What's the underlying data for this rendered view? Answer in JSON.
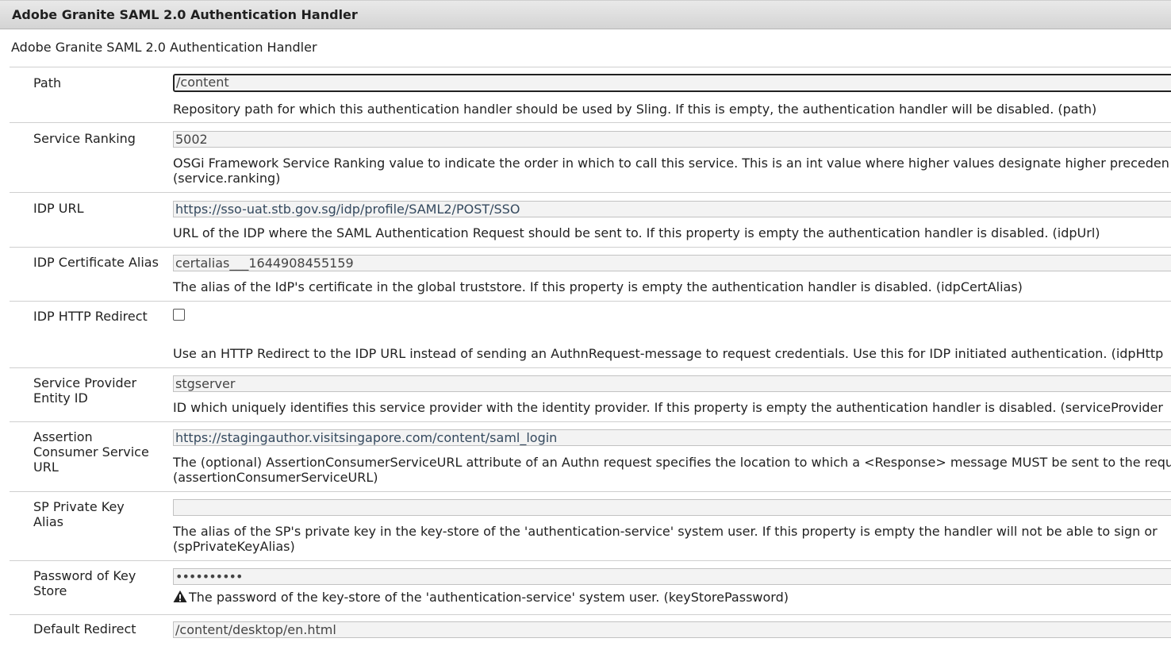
{
  "window": {
    "title": "Adobe Granite SAML 2.0 Authentication Handler"
  },
  "subtitle": "Adobe Granite SAML 2.0 Authentication Handler",
  "fields": [
    {
      "label": "Path",
      "value": "/content",
      "description": "Repository path for which this authentication handler should be used by Sling. If this is empty, the authentication handler will be disabled. (path)"
    },
    {
      "label": "Service Ranking",
      "value": "5002",
      "description_line1": "OSGi Framework Service Ranking value to indicate the order in which to call this service. This is an int value where higher values designate higher preceden",
      "description_line2": "(service.ranking)"
    },
    {
      "label": "IDP URL",
      "value": "https://sso-uat.stb.gov.sg/idp/profile/SAML2/POST/SSO",
      "description": "URL of the IDP where the SAML Authentication Request should be sent to. If this property is empty the authentication handler is disabled. (idpUrl)"
    },
    {
      "label": "IDP Certificate Alias",
      "value": "certalias___1644908455159",
      "description": "The alias of the IdP's certificate in the global truststore. If this property is empty the authentication handler is disabled. (idpCertAlias)"
    },
    {
      "label": "IDP HTTP Redirect",
      "checked": false,
      "description": "Use an HTTP Redirect to the IDP URL instead of sending an AuthnRequest-message to request credentials. Use this for IDP initiated authentication. (idpHttp"
    },
    {
      "label_line1": "Service Provider",
      "label_line2": "Entity ID",
      "value": "stgserver",
      "description": "ID which uniquely identifies this service provider with the identity provider. If this property is empty the authentication handler is disabled. (serviceProvider"
    },
    {
      "label_line1": "Assertion",
      "label_line2": "Consumer Service",
      "label_line3": "URL",
      "value": "https://stagingauthor.visitsingapore.com/content/saml_login",
      "description_line1": "The (optional) AssertionConsumerServiceURL attribute of an Authn request specifies the location to which a <Response> message MUST be sent to the requ",
      "description_line2": "(assertionConsumerServiceURL)"
    },
    {
      "label_line1": "SP Private Key",
      "label_line2": "Alias",
      "value": "",
      "description_line1": "The alias of the SP's private key in the key-store of the 'authentication-service' system user. If this property is empty the handler will not be able to sign or",
      "description_line2": "(spPrivateKeyAlias)"
    },
    {
      "label_line1": "Password of Key",
      "label_line2": "Store",
      "value": "••••••••••",
      "description": "The password of the key-store of the 'authentication-service' system user. (keyStorePassword)",
      "icon": "warning-icon"
    },
    {
      "label": "Default Redirect",
      "value": "/content/desktop/en.html"
    }
  ]
}
